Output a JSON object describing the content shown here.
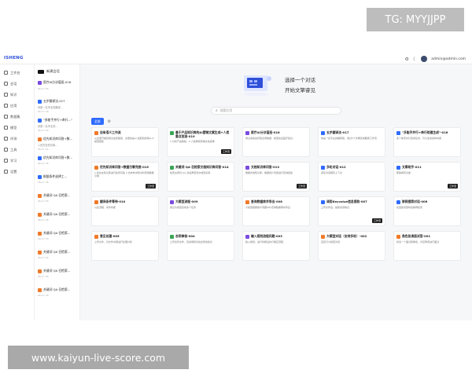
{
  "watermarks": {
    "top": "TG: MYYJJPP",
    "bottom": "www.kaiyun-live-score.com"
  },
  "topbar": {
    "logo": "ISHENG",
    "user": "admin@admin.com"
  },
  "nav": {
    "items": [
      {
        "label": "工作台"
      },
      {
        "label": "会话"
      },
      {
        "label": "知识"
      },
      {
        "label": "应用"
      },
      {
        "label": "数据集"
      },
      {
        "label": "模型"
      },
      {
        "label": "评测"
      },
      {
        "label": "工具"
      },
      {
        "label": "学习"
      },
      {
        "label": "设置"
      }
    ]
  },
  "conversations": {
    "new_label": "新建会话",
    "items": [
      {
        "title": "医疗AI分诊值班-018",
        "sub": "",
        "date": "06-17 18",
        "color": "#7b4ce0"
      },
      {
        "title": "五步翻译法-017",
        "sub": "你是一名专业的翻译...",
        "date": "06-17 18",
        "color": "#2f6bff"
      },
      {
        "title": "\"多能手并行+串行...\"",
        "sub": "你是一名专业的...",
        "date": "06-17 18",
        "color": "#2f6bff"
      },
      {
        "title": "优先知识库问答+数...",
        "sub": "1.优先在知识库...",
        "date": "06-17 18",
        "color": "#f07a2a"
      },
      {
        "title": "优先知识库问答+数...",
        "sub": "",
        "date": "06-17 18",
        "color": "#2f6bff"
      },
      {
        "title": "根据条件选择工...",
        "sub": "",
        "date": "06-17 18",
        "color": "#2f6bff"
      },
      {
        "title": "关键词 QA 召检索...",
        "sub": "",
        "date": "06-17 18",
        "color": "#f07a2a"
      },
      {
        "title": "关键词 QA 召检索...",
        "sub": "",
        "date": "06-17 18",
        "color": "#f07a2a"
      },
      {
        "title": "关键词 QA 召检索...",
        "sub": "",
        "date": "06-17 18",
        "color": "#f07a2a"
      },
      {
        "title": "关键词 QA 召检索...",
        "sub": "",
        "date": "06-17 18",
        "color": "#f07a2a"
      },
      {
        "title": "关键词 QA 召检索...",
        "sub": "",
        "date": "06-17 18",
        "color": "#f07a2a"
      },
      {
        "title": "关键词 QA 召检索...",
        "sub": "",
        "date": "06-17 18",
        "color": "#f07a2a"
      }
    ]
  },
  "main": {
    "hero_title": "选择一个对话",
    "hero_sub": "开始文擎睿见",
    "search_placeholder": "搜索应用",
    "tab_active": "全部"
  },
  "cards": [
    {
      "title": "自有语义工作流",
      "desc": "从这里开始就通过最佳路径，这里的是ai 适配和通用ai-3-模型搭建",
      "color": "#f07a2a",
      "tag": ""
    },
    {
      "title": "基于产品知识库的AI营销文案生成+人类重点批准-019",
      "desc": "1.分析产品规格、2.人类审核营销文案选择",
      "color": "#3aa655",
      "tag": "工作流"
    },
    {
      "title": "医疗AI分诊值班-018",
      "desc": "通过多模态获取患者数据、模型给出医疗建议...",
      "color": "#7b4ce0",
      "tag": ""
    },
    {
      "title": "五步翻译法-017",
      "desc": "你是一名专业的翻译官，通过5个步骤完成翻译工作流",
      "color": "#2f6bff",
      "tag": ""
    },
    {
      "title": "\"多能手并行+串行助理生成\"-016",
      "desc": "多个助手并行完成任务，可以生成多种内容",
      "color": "#2f6bff",
      "tag": ""
    },
    {
      "title": "优先知识库问答+数据引擎兜底-015",
      "desc": "1.优先在知识库进行检索问答 2.当未命中知识时调用数据引擎",
      "color": "#f07a2a",
      "tag": "工作流"
    },
    {
      "title": "关键词 QA 召检索文档知识库问答-014",
      "desc": "检索关键词 QA 对后再查找文档知识库",
      "color": "#3aa655",
      "tag": ""
    },
    {
      "title": "文档知识库问答-013",
      "desc": "根据文档知识库，根据用户问题进行查询回答",
      "color": "#7b4ce0",
      "tag": "工作流"
    },
    {
      "title": "多轮对话-012",
      "desc": "多轮对话保存上下文",
      "color": "#2f6bff",
      "tag": ""
    },
    {
      "title": "文章助手-011",
      "desc": "帮助撰写文章",
      "color": "#2f6bff",
      "tag": "工作流"
    },
    {
      "title": "翻译条件等待-010",
      "desc": "以此流程，条件判断",
      "color": "#f07a2a",
      "tag": ""
    },
    {
      "title": "大模型流程-009",
      "desc": "通过大模型完成多个任务",
      "color": "#7b4ce0",
      "tag": ""
    },
    {
      "title": "查询数据库并导出-008",
      "desc": "大模型根据用户意图SQL查询数据库并导出",
      "color": "#f07a2a",
      "tag": ""
    },
    {
      "title": "调用Keyvalue信息提取-007",
      "desc": "上传文件后，提取关键信息",
      "color": "#2f6bff",
      "tag": "工作流"
    },
    {
      "title": "联网搜索对话-006",
      "desc": "在回答问题时会联网检索",
      "color": "#2f6bff",
      "tag": ""
    },
    {
      "title": "意见处理-005",
      "desc": "上传文件，对文件内容进行处理分析",
      "color": "#f07a2a",
      "tag": ""
    },
    {
      "title": "合同审核-004",
      "desc": "上传合同文件，自动审核并给出修改建议",
      "color": "#3aa655",
      "tag": ""
    },
    {
      "title": "输入规划流程问题-003",
      "desc": "输入规划，进行判断后执行相应流程",
      "color": "#7b4ce0",
      "tag": ""
    },
    {
      "title": "大模型对话（支持多轮）-002",
      "desc": "直接与大模型对话",
      "color": "#f07a2a",
      "tag": ""
    },
    {
      "title": "角色扮演面试官-001",
      "desc": "扮演一个面试官角色，对应聘者进行面试",
      "color": "#f07a2a",
      "tag": ""
    }
  ],
  "colors": {
    "accent": "#2f6bff",
    "orange": "#f07a2a",
    "green": "#3aa655",
    "purple": "#7b4ce0"
  }
}
